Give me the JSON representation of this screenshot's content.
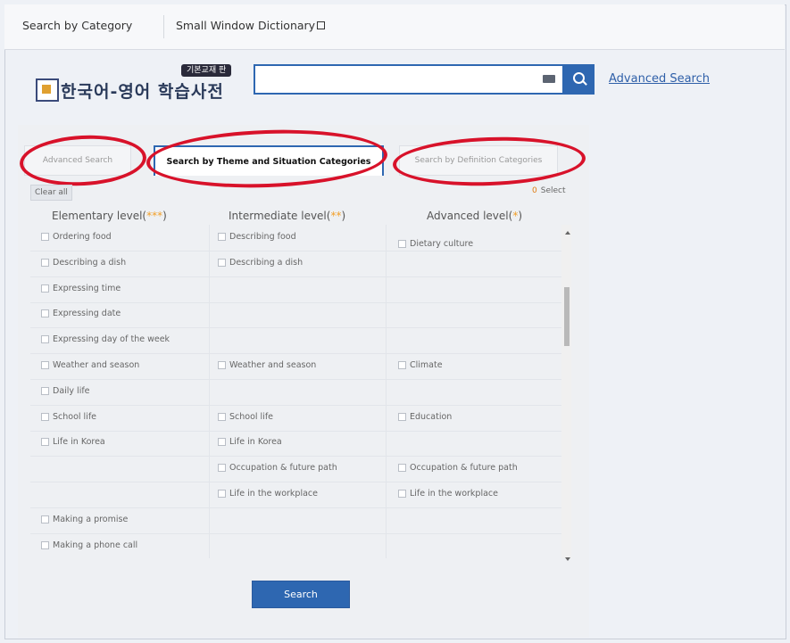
{
  "topnav": {
    "items": [
      {
        "label": "Search by Category"
      },
      {
        "label": "Small Window Dictionary"
      }
    ]
  },
  "header": {
    "logo_title": "한국어-영어 학습사전",
    "logo_badge": "기본교재 판",
    "search_value": "",
    "advanced_search_link": "Advanced Search"
  },
  "tabs": [
    {
      "label": "Advanced Search"
    },
    {
      "label": "Search by Theme and Situation Categories"
    },
    {
      "label": "Search by Definition Categories"
    }
  ],
  "controls": {
    "clear_all": "Clear all",
    "selected_count": "0",
    "selected_label": "Select"
  },
  "columns": [
    {
      "label": "Elementary level(",
      "stars": "***",
      "close": ")"
    },
    {
      "label": "Intermediate level(",
      "stars": "**",
      "close": ")"
    },
    {
      "label": "Advanced level(",
      "stars": "*",
      "close": ")"
    }
  ],
  "rows": [
    {
      "elementary": "Ordering food",
      "intermediate": "Describing food",
      "advanced": "Dietary culture"
    },
    {
      "elementary": "Describing a dish",
      "intermediate": "Describing a dish",
      "advanced": ""
    },
    {
      "elementary": "Expressing time",
      "intermediate": "",
      "advanced": ""
    },
    {
      "elementary": "Expressing date",
      "intermediate": "",
      "advanced": ""
    },
    {
      "elementary": "Expressing day of the week",
      "intermediate": "",
      "advanced": ""
    },
    {
      "elementary": "Weather and season",
      "intermediate": "Weather and season",
      "advanced": "Climate"
    },
    {
      "elementary": "Daily life",
      "intermediate": "",
      "advanced": ""
    },
    {
      "elementary": "School life",
      "intermediate": "School life",
      "advanced": "Education"
    },
    {
      "elementary": "Life in Korea",
      "intermediate": "Life in Korea",
      "advanced": ""
    },
    {
      "elementary": "",
      "intermediate": "Occupation & future path",
      "advanced": "Occupation & future path"
    },
    {
      "elementary": "",
      "intermediate": "Life in the workplace",
      "advanced": "Life in the workplace"
    },
    {
      "elementary": "Making a promise",
      "intermediate": "",
      "advanced": ""
    },
    {
      "elementary": "Making a phone call",
      "intermediate": "",
      "advanced": ""
    }
  ],
  "search_button": "Search",
  "colors": {
    "accent": "#2e67b1",
    "highlight_ring": "#d8122a",
    "star": "#f2a02a"
  }
}
